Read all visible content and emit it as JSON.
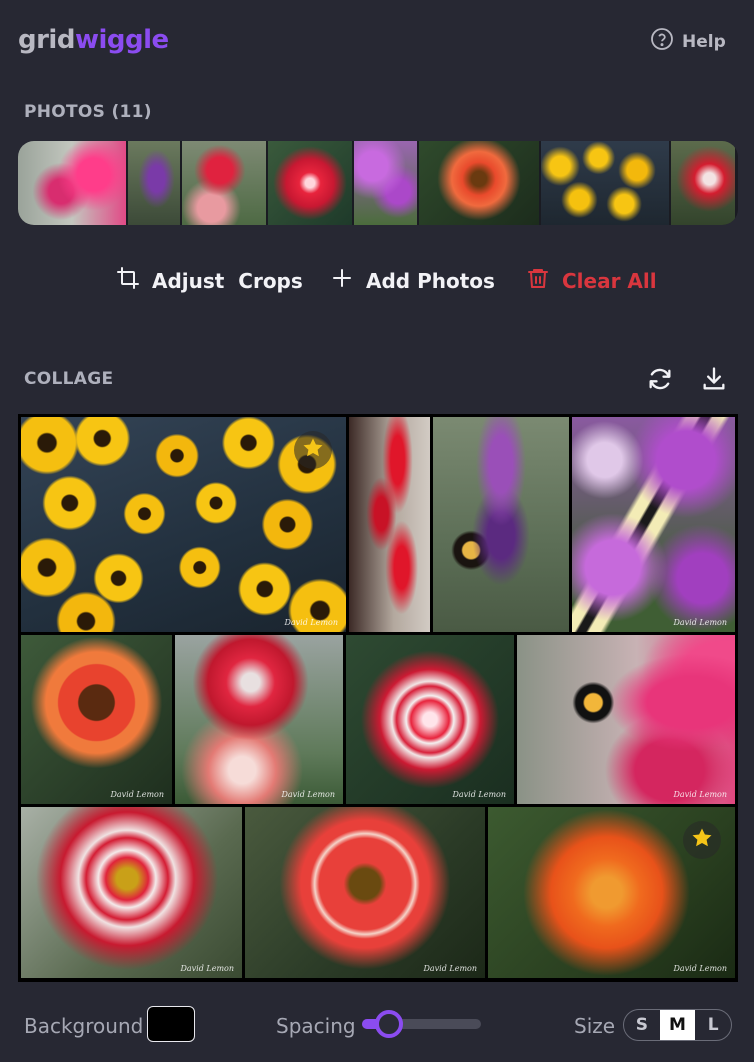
{
  "header": {
    "logo_part1": "grid",
    "logo_part2": "wiggle",
    "help_label": "Help"
  },
  "photos": {
    "title": "PHOTOS (11)"
  },
  "actions": {
    "adjust_crops": "Adjust  Crops",
    "add_photos": "Add Photos",
    "clear_all": "Clear All"
  },
  "collage": {
    "title": "COLLAGE",
    "watermark": "David Lemon"
  },
  "footer": {
    "background_label": "Background",
    "background_color": "#000000",
    "spacing_label": "Spacing",
    "spacing_value": 0.12,
    "size_label": "Size",
    "size_options": [
      "S",
      "M",
      "L"
    ],
    "size_selected": "M"
  },
  "colors": {
    "accent": "#8b4cf0",
    "danger": "#d9363e",
    "bg": "#272833"
  }
}
